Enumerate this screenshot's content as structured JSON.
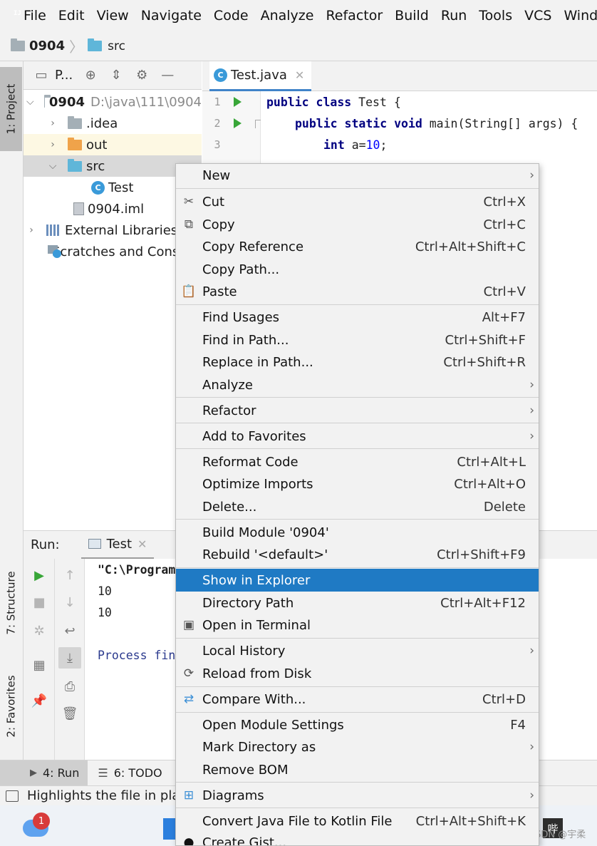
{
  "menubar": {
    "items": [
      "File",
      "Edit",
      "View",
      "Navigate",
      "Code",
      "Analyze",
      "Refactor",
      "Build",
      "Run",
      "Tools",
      "VCS",
      "Wind"
    ]
  },
  "breadcrumb": {
    "root": "0904",
    "child": "src"
  },
  "left_stripe": {
    "project": "1: Project",
    "structure": "7: Structure",
    "favorites": "2: Favorites"
  },
  "project_panel": {
    "title": "P...",
    "tree": {
      "root_name": "0904",
      "root_path": "D:\\java\\111\\0904",
      "idea": ".idea",
      "out": "out",
      "src": "src",
      "test": "Test",
      "iml": "0904.iml",
      "libs": "External Libraries",
      "scratches": "Scratches and Consoles"
    }
  },
  "editor": {
    "tab_label": "Test.java",
    "line_numbers": [
      "1",
      "2",
      "3"
    ],
    "lines": {
      "l1_kw": "public class",
      "l1_rest": " Test {",
      "l2_kw": "public static void",
      "l2_rest": " main(String[] args) {",
      "l3_kw": "int",
      "l3_var": " a=",
      "l3_num": "10",
      "l3_end": ";"
    }
  },
  "run_panel": {
    "label": "Run:",
    "tab": "Test",
    "console": [
      "\"C:\\Program",
      "10",
      "10",
      "Process fin"
    ]
  },
  "bottom_tabs": {
    "run": "4: Run",
    "todo": "6: TODO"
  },
  "status": {
    "text": "Highlights the file in platform's file manager"
  },
  "taskbar": {
    "badge": "1",
    "ime": "哔",
    "watermark": "CSDN @宇柔"
  },
  "context_menu": {
    "new": "New",
    "cut": "Cut",
    "cut_sc": "Ctrl+X",
    "copy": "Copy",
    "copy_sc": "Ctrl+C",
    "copy_ref": "Copy Reference",
    "copy_ref_sc": "Ctrl+Alt+Shift+C",
    "copy_path": "Copy Path...",
    "paste": "Paste",
    "paste_sc": "Ctrl+V",
    "find_usages": "Find Usages",
    "find_usages_sc": "Alt+F7",
    "find_in_path": "Find in Path...",
    "find_in_path_sc": "Ctrl+Shift+F",
    "replace_in_path": "Replace in Path...",
    "replace_in_path_sc": "Ctrl+Shift+R",
    "analyze": "Analyze",
    "refactor": "Refactor",
    "add_favorites": "Add to Favorites",
    "reformat": "Reformat Code",
    "reformat_sc": "Ctrl+Alt+L",
    "optimize": "Optimize Imports",
    "optimize_sc": "Ctrl+Alt+O",
    "delete": "Delete...",
    "delete_sc": "Delete",
    "build_module": "Build Module '0904'",
    "rebuild": "Rebuild '<default>'",
    "rebuild_sc": "Ctrl+Shift+F9",
    "show_explorer": "Show in Explorer",
    "dir_path": "Directory Path",
    "dir_path_sc": "Ctrl+Alt+F12",
    "open_terminal": "Open in Terminal",
    "local_history": "Local History",
    "reload": "Reload from Disk",
    "compare": "Compare With...",
    "compare_sc": "Ctrl+D",
    "module_settings": "Open Module Settings",
    "module_settings_sc": "F4",
    "mark_dir": "Mark Directory as",
    "remove_bom": "Remove BOM",
    "diagrams": "Diagrams",
    "convert_kotlin": "Convert Java File to Kotlin File",
    "convert_kotlin_sc": "Ctrl+Alt+Shift+K",
    "create_gist": "Create Gist..."
  },
  "colors": {
    "selection": "#1f7ac4",
    "accent_tab": "#4083c9",
    "run_green": "#38a638"
  }
}
